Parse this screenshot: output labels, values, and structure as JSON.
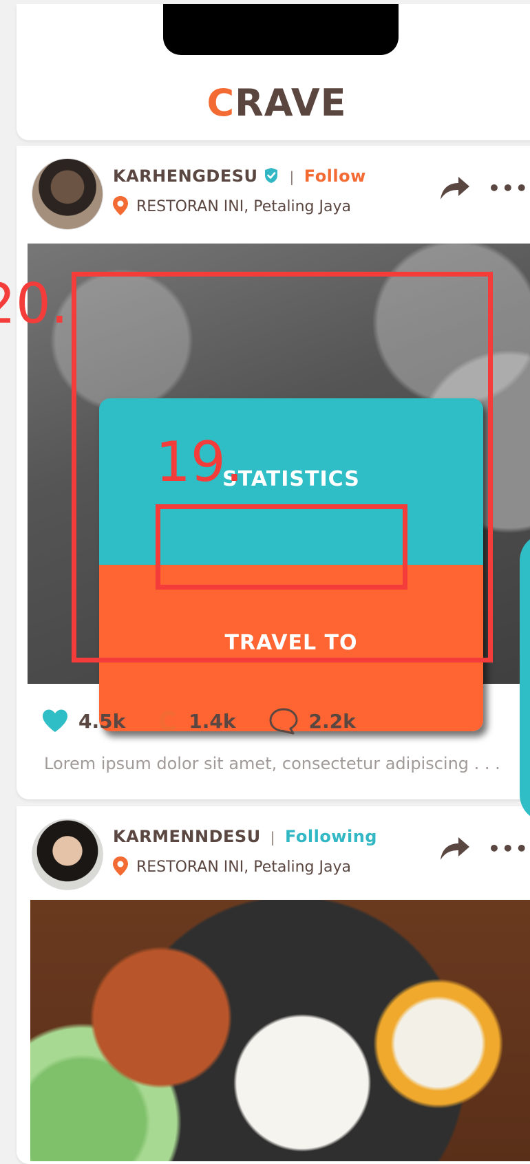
{
  "app": {
    "logo_letter": "C",
    "logo_rest": "RAVE",
    "brand_colors": {
      "orange": "#f46a33",
      "teal": "#2fbdc6",
      "brown": "#5b4741"
    }
  },
  "annotations": {
    "outer_label": "20.",
    "inner_label": "19."
  },
  "posts": [
    {
      "username": "KARHENGDESU",
      "verified": true,
      "separator": "|",
      "follow_label": "Follow",
      "location": "RESTORAN INI, Petaling Jaya",
      "icons": {
        "share": "share-icon",
        "more": "more-icon"
      },
      "more_text": "•••",
      "popup": {
        "statistics_label": "STATISTICS",
        "travel_label": "TRAVEL TO"
      },
      "likes": "4.5k",
      "craves": "1.4k",
      "comments": "2.2k",
      "caption": "Lorem ipsum dolor sit amet, consectetur adipiscing . . ."
    },
    {
      "username": "KARMENNDESU",
      "verified": false,
      "separator": "|",
      "follow_label": "Following",
      "location": "RESTORAN INI, Petaling Jaya",
      "more_text": "•••"
    }
  ]
}
